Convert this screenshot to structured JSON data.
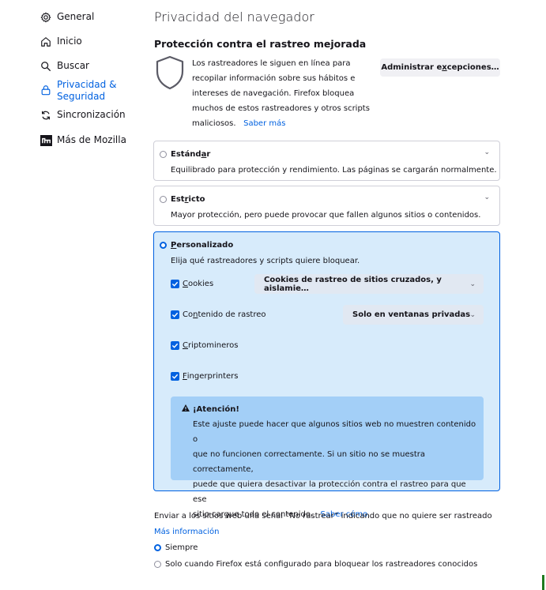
{
  "sidebar": {
    "items": [
      {
        "label": "General",
        "icon": "gear-icon"
      },
      {
        "label": "Inicio",
        "icon": "home-icon"
      },
      {
        "label": "Buscar",
        "icon": "search-icon"
      },
      {
        "label": "Privacidad &",
        "label2": "Seguridad",
        "icon": "lock-icon",
        "active": true
      },
      {
        "label": "Sincronización",
        "icon": "sync-icon"
      },
      {
        "label": "Más de Mozilla",
        "icon": "mozilla-icon"
      }
    ]
  },
  "main": {
    "title": "Privacidad del navegador",
    "etp": {
      "title": "Protección contra el rastreo mejorada",
      "intro_lines": [
        "Los rastreadores le siguen en línea para",
        "recopilar información sobre sus hábitos e",
        "intereses de navegación. Firefox bloquea",
        "muchos de estos rastreadores y otros scripts",
        "maliciosos."
      ],
      "learn_more": "Saber más",
      "manage_pre": "Administrar e",
      "manage_ul": "x",
      "manage_post": "cepciones…"
    },
    "standard": {
      "title_pre": "Estánd",
      "title_ul": "a",
      "title_post": "r",
      "desc": "Equilibrado para protección y rendimiento. Las páginas se cargarán normalmente."
    },
    "strict": {
      "title_pre": "Est",
      "title_ul": "r",
      "title_post": "icto",
      "desc": "Mayor protección, pero puede provocar que fallen algunos sitios o contenidos."
    },
    "custom": {
      "title_ul": "P",
      "title_post": "ersonalizado",
      "desc": "Elija qué rastreadores y scripts quiere bloquear.",
      "cookies": {
        "ul": "C",
        "rest": "ookies",
        "dropdown": "Cookies de rastreo de sitios cruzados, y aislamie…"
      },
      "tracking": {
        "pre": "Co",
        "ul": "n",
        "rest": "tenido de rastreo",
        "dropdown": "Solo en ventanas privadas"
      },
      "crypto": {
        "ul": "C",
        "rest": "riptomineros"
      },
      "fingerprint": {
        "ul": "F",
        "rest": "ingerprinters"
      },
      "warning": {
        "title": "¡Atención!",
        "lines": [
          "Este ajuste puede hacer que algunos sitios web no muestren contenido o",
          "que no funcionen correctamente. Si un sitio no se muestra correctamente,",
          "puede que quiera desactivar la protección contra el rastreo para que ese",
          "sitio cargue todo el contenido."
        ],
        "link": "Saber cómo"
      }
    },
    "dnt": {
      "text": "Enviar a los sitios web una señal “No rastrear” indicando que no quiere ser rastreado",
      "more": "Más información",
      "opt_always": "Siempre",
      "opt_only": "Solo cuando Firefox está configurado para bloquear los rastreadores conocidos"
    }
  },
  "colors": {
    "accent": "#0061e0",
    "selected_bg": "#d7ebfb",
    "warning_bg": "#a3cff7"
  }
}
